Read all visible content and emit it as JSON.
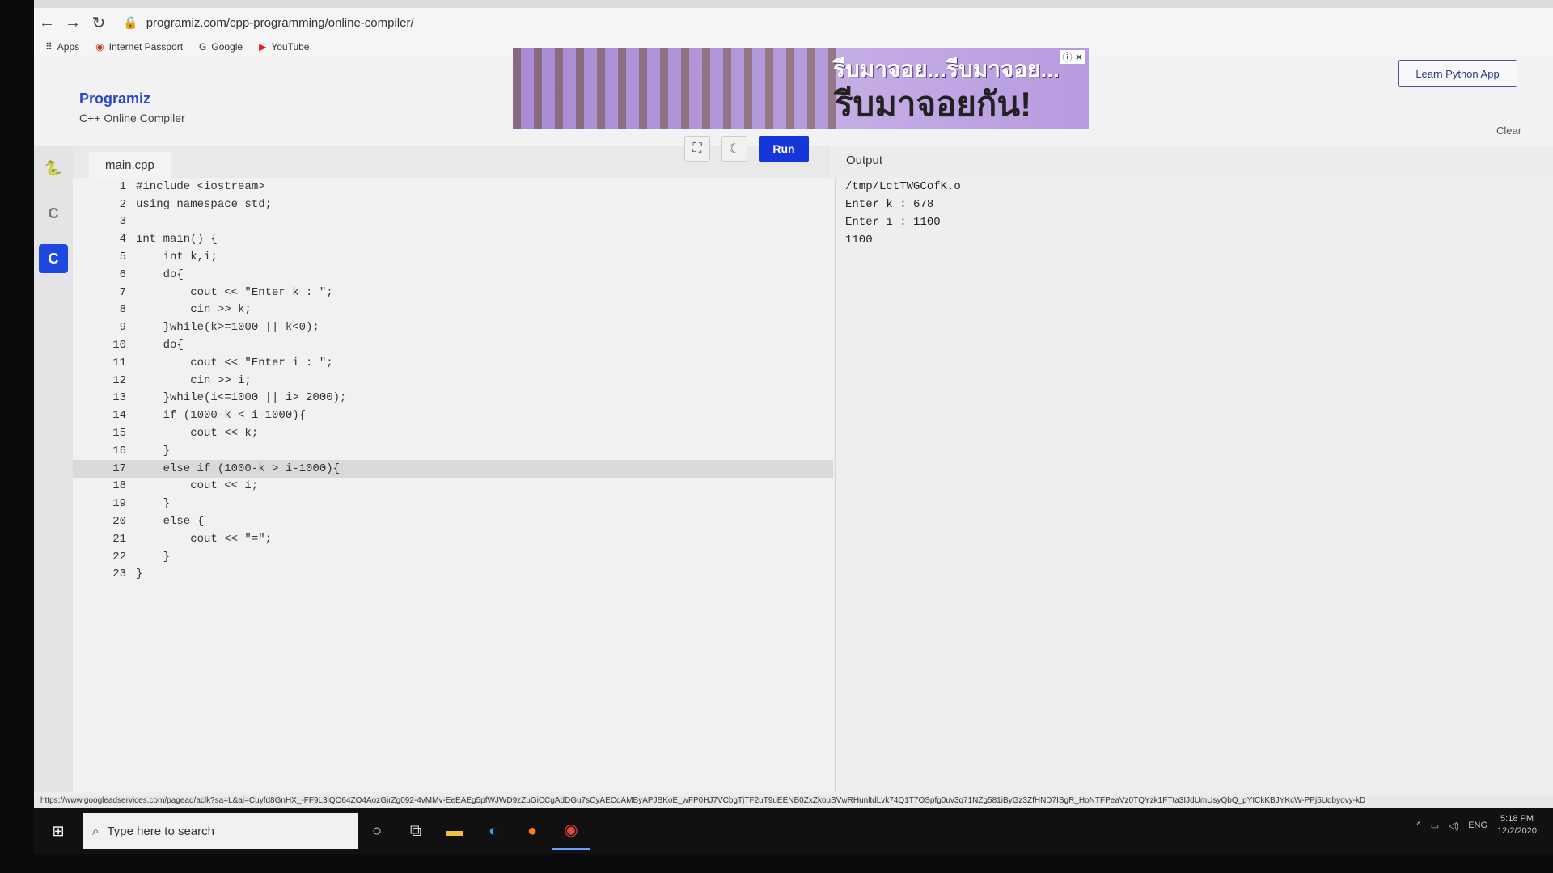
{
  "browser": {
    "url": "programiz.com/cpp-programming/online-compiler/",
    "bookmarks": [
      "Apps",
      "Internet Passport",
      "Google",
      "YouTube"
    ]
  },
  "header": {
    "logo": "Programiz",
    "subtitle": "C++ Online Compiler",
    "learn_button": "Learn Python App",
    "ad_text_top": "รีบมาจอย...รีบมาจอย...",
    "ad_text_bottom": "รีบมาจอยกัน!"
  },
  "sidebar": {
    "items": [
      {
        "icon": "python-icon",
        "glyph": "🐍"
      },
      {
        "icon": "c-icon",
        "glyph": "C"
      },
      {
        "icon": "cpp-icon",
        "glyph": "C"
      }
    ]
  },
  "editor": {
    "tab": "main.cpp",
    "run_label": "Run",
    "highlighted_line": 17,
    "lines": [
      "#include <iostream>",
      "using namespace std;",
      "",
      "int main() {",
      "    int k,i;",
      "    do{",
      "        cout << \"Enter k : \";",
      "        cin >> k;",
      "    }while(k>=1000 || k<0);",
      "    do{",
      "        cout << \"Enter i : \";",
      "        cin >> i;",
      "    }while(i<=1000 || i> 2000);",
      "    if (1000-k < i-1000){",
      "        cout << k;",
      "    }",
      "    else if (1000-k > i-1000){",
      "        cout << i;",
      "    }",
      "    else {",
      "        cout << \"=\";",
      "    }",
      "}"
    ]
  },
  "output": {
    "label": "Output",
    "clear_label": "Clear",
    "lines": [
      "/tmp/LctTWGCofK.o",
      "Enter k : 678",
      "Enter i : 1100",
      "1100"
    ]
  },
  "status_url": "https://www.googleadservices.com/pagead/aclk?sa=L&ai=Cuyfd8GnHX_-FF9L3iQO64ZO4AozGjrZg092-4vMMv-EeEAEg5pfWJWD9zZuGiCCgAdDGu7sCyAECqAMByAPJBKoE_wFP0HJ7VCbgTjTF2uT9uEENB0ZxZkouSVwRHunltdLvk74Q1T7OSpfg0uv3q71NZg581iByGz3ZfHND7ISgR_HoNTFPeaVz0TQYzk1FTta3IJdUmUsyQbQ_pYICkKBJYKcW-PPj5Uqbyovy-kD",
  "taskbar": {
    "search_placeholder": "Type here to search",
    "language": "ENG",
    "time": "5:18 PM",
    "date": "12/2/2020"
  }
}
